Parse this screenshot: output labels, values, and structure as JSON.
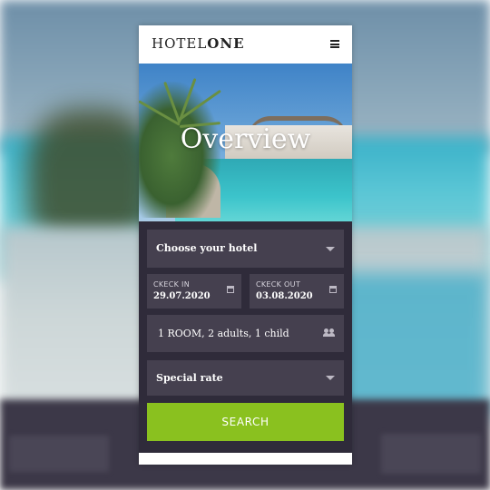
{
  "brand": {
    "light": "HOTEL",
    "bold": "ONE"
  },
  "hero": {
    "title": "Overview"
  },
  "form": {
    "hotel_select": "Choose your hotel",
    "check_in": {
      "label": "CKECK IN",
      "value": "29.07.2020"
    },
    "check_out": {
      "label": "CKECK OUT",
      "value": "03.08.2020"
    },
    "rooms": "1 ROOM, 2 adults, 1 child",
    "rate_select": "Special rate",
    "search_label": "SEARCH"
  },
  "icons": {
    "menu": "hamburger-menu-icon",
    "hotel_caret": "chevron-down-icon",
    "check_in": "calendar-icon",
    "check_out": "calendar-icon",
    "guests": "people-icon",
    "rate_caret": "chevron-down-icon"
  },
  "colors": {
    "search_button": "#8ac11f",
    "form_background": "#2f2b3a",
    "field_background": "#45404f"
  }
}
